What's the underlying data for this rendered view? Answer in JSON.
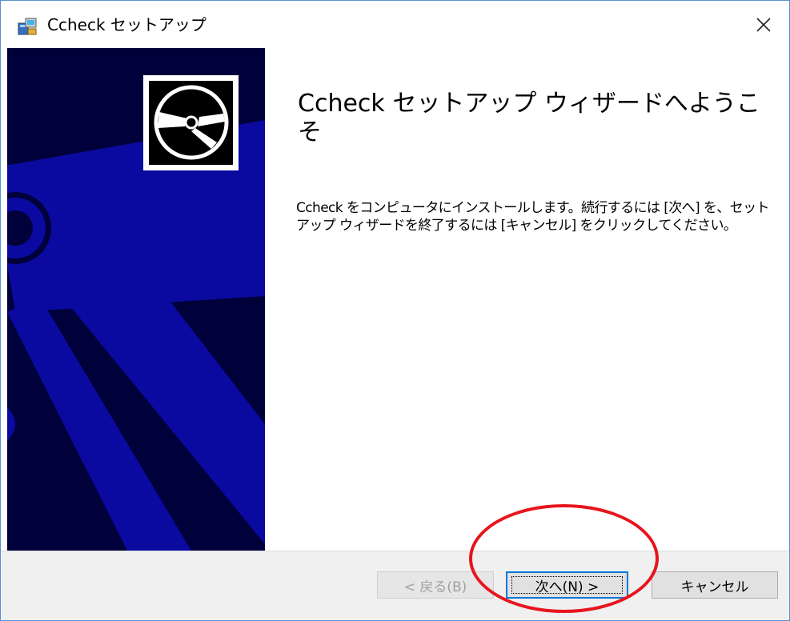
{
  "window": {
    "title": "Ccheck セットアップ"
  },
  "icons": {
    "app": "installer-package-icon",
    "close": "close-icon",
    "disc": "cd-disc-icon"
  },
  "content": {
    "heading": "Ccheck セットアップ ウィザードへようこそ",
    "body": "Ccheck をコンピュータにインストールします。続行するには [次へ] を、セットアップ ウィザードを終了するには [キャンセル] をクリックしてください。"
  },
  "buttons": {
    "back": "< 戻る(B)",
    "next": "次へ(N) >",
    "cancel": "キャンセル"
  },
  "colors": {
    "banner_bg": "#00003a",
    "banner_accent": "#0a0aa0",
    "highlight_ellipse": "#e8151d",
    "focus_border": "#0078d7"
  }
}
